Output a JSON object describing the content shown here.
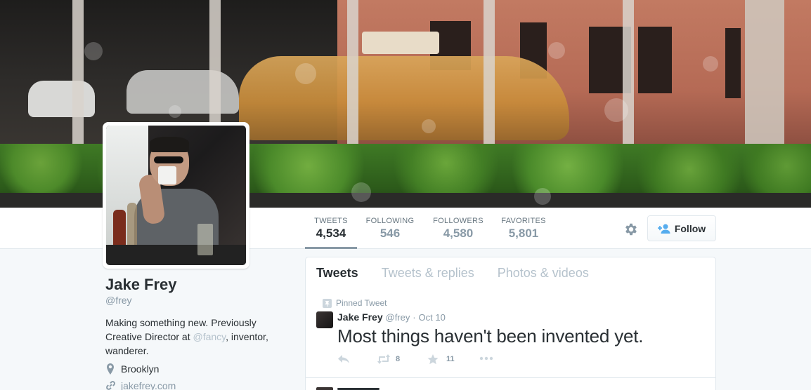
{
  "profile": {
    "name": "Jake Frey",
    "handle": "@frey",
    "bio_before": "Making something new. Previously Creative Director at ",
    "bio_mention": "@fancy",
    "bio_after": ", inventor, wanderer.",
    "location": "Brooklyn",
    "website": "jakefrey.com"
  },
  "stats": [
    {
      "label": "TWEETS",
      "value": "4,534",
      "active": true
    },
    {
      "label": "FOLLOWING",
      "value": "546",
      "active": false
    },
    {
      "label": "FOLLOWERS",
      "value": "4,580",
      "active": false
    },
    {
      "label": "FAVORITES",
      "value": "5,801",
      "active": false
    }
  ],
  "actions": {
    "follow_label": "Follow",
    "settings_icon": "gear-icon",
    "follow_icon": "add-user-icon"
  },
  "timeline": {
    "tabs": [
      {
        "label": "Tweets",
        "active": true
      },
      {
        "label": "Tweets & replies",
        "active": false
      },
      {
        "label": "Photos & videos",
        "active": false
      }
    ],
    "pinned_tweet": {
      "pinned_label": "Pinned Tweet",
      "author_name": "Jake Frey",
      "author_handle": "@frey",
      "separator": "·",
      "date": "Oct 10",
      "text": "Most things haven't been invented yet.",
      "retweets": "8",
      "favorites": "11"
    }
  },
  "colors": {
    "accent": "#55acee",
    "text": "#292f33",
    "muted": "#8899a6",
    "border": "#e1e8ed",
    "background": "#f5f8fa"
  }
}
